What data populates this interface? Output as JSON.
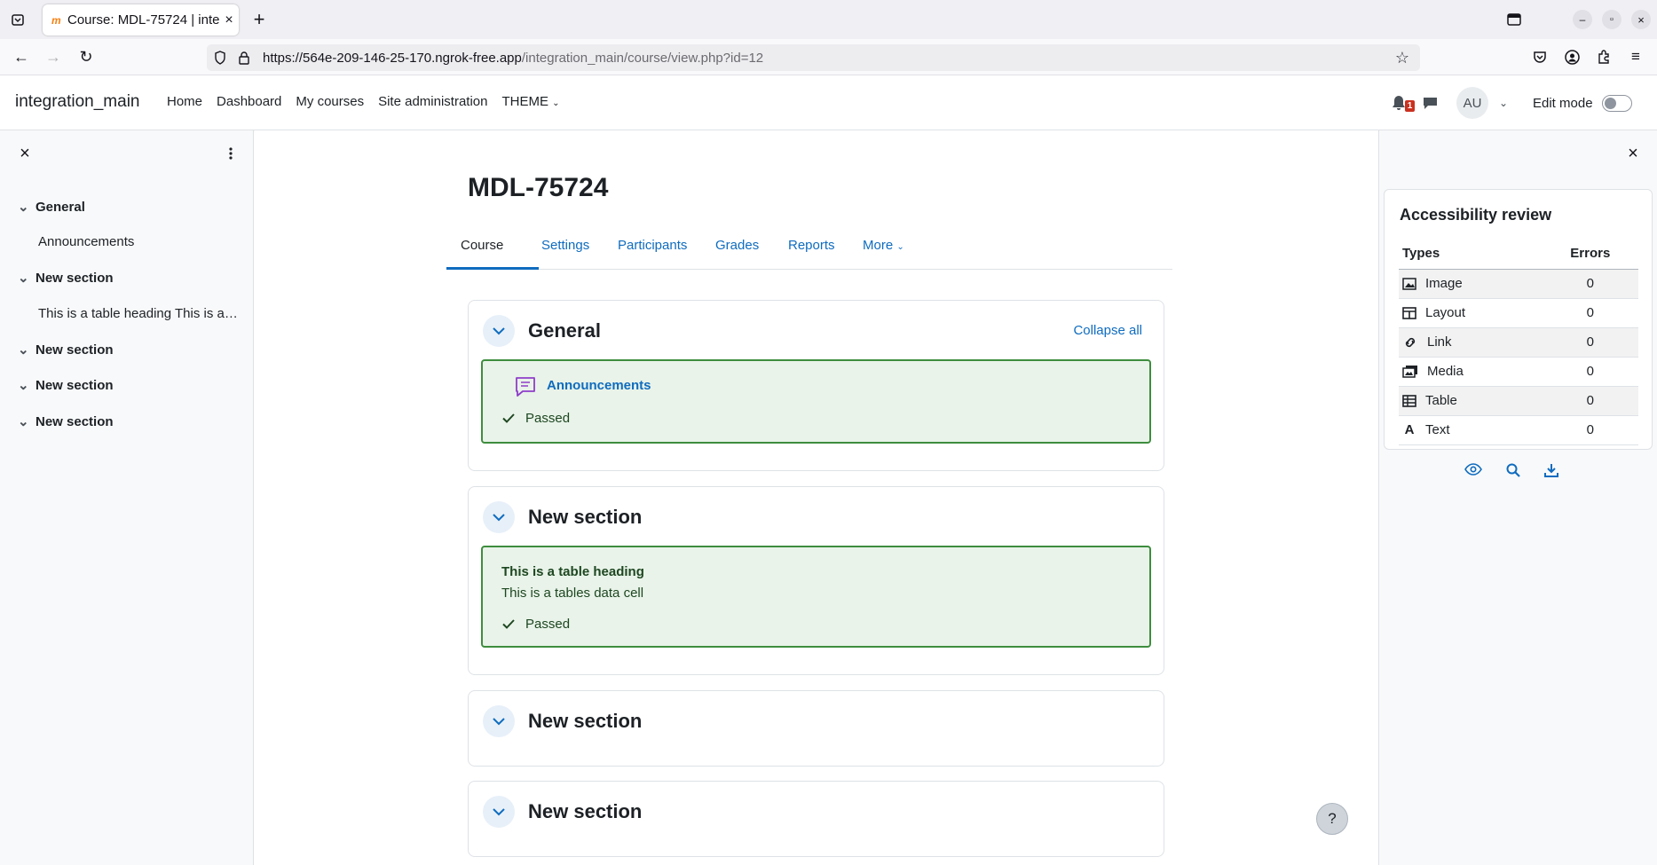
{
  "browser": {
    "tab_title": "Course: MDL-75724 | inte",
    "tab_favicon": "m",
    "url_host": "https://564e-209-146-25-170.ngrok-free.app",
    "url_path": "/integration_main/course/view.php?id=12"
  },
  "header": {
    "site_name": "integration_main",
    "nav": [
      "Home",
      "Dashboard",
      "My courses",
      "Site administration",
      "THEME"
    ],
    "notification_count": "1",
    "avatar_initials": "AU",
    "edit_mode_label": "Edit mode"
  },
  "course_index": {
    "items": [
      {
        "label": "General",
        "sub": "Announcements"
      },
      {
        "label": "New section",
        "sub": "This is a table heading This is a tables data cell"
      },
      {
        "label": "New section"
      },
      {
        "label": "New section"
      },
      {
        "label": "New section"
      }
    ]
  },
  "main": {
    "title": "MDL-75724",
    "tabs": [
      "Course",
      "Settings",
      "Participants",
      "Grades",
      "Reports",
      "More"
    ],
    "collapse_all": "Collapse all",
    "sections": [
      {
        "title": "General",
        "activity": "Announcements",
        "status": "Passed"
      },
      {
        "title": "New section",
        "table_heading": "This is a table heading",
        "table_cell": "This is a tables data cell",
        "status": "Passed"
      },
      {
        "title": "New section"
      },
      {
        "title": "New section"
      }
    ]
  },
  "accessibility_review": {
    "title": "Accessibility review",
    "col_types": "Types",
    "col_errors": "Errors",
    "rows": [
      {
        "type": "Image",
        "errors": "0",
        "icon": "image-icon"
      },
      {
        "type": "Layout",
        "errors": "0",
        "icon": "layout-icon"
      },
      {
        "type": "Link",
        "errors": "0",
        "icon": "link-icon"
      },
      {
        "type": "Media",
        "errors": "0",
        "icon": "media-icon"
      },
      {
        "type": "Table",
        "errors": "0",
        "icon": "table-icon"
      },
      {
        "type": "Text",
        "errors": "0",
        "icon": "text-icon"
      }
    ]
  },
  "help_label": "?"
}
